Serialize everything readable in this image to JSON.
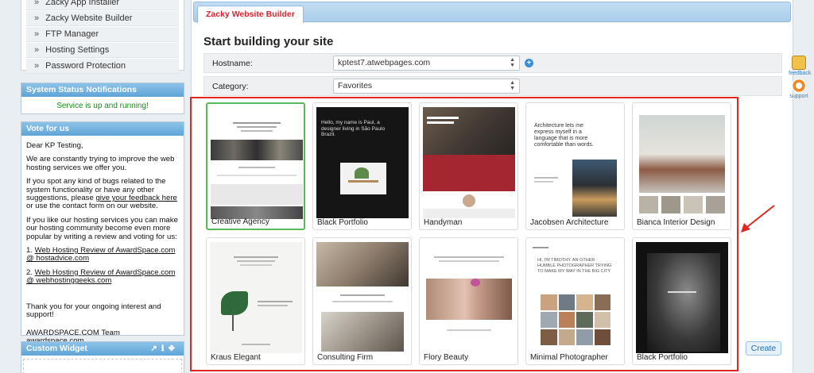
{
  "sidebar": {
    "menu_items": [
      {
        "label": "Zacky App Installer"
      },
      {
        "label": "Zacky Website Builder"
      },
      {
        "label": "FTP Manager"
      },
      {
        "label": "Hosting Settings"
      },
      {
        "label": "Password Protection"
      }
    ],
    "status_panel": {
      "title": "System Status Notifications",
      "message": "Service is up and running!"
    },
    "vote_panel": {
      "title": "Vote for us",
      "greeting": "Dear KP Testing,",
      "p1": "We are constantly trying to improve the web hosting services we offer you.",
      "p2_pre": "If you spot any kind of bugs related to the system functionality or have any other suggestions, please ",
      "p2_link": "give your feedback here",
      "p2_post": " or use the contact form on our website.",
      "p3": "If you like our hosting services you can make our hosting community become even more popular by writing a review and voting for us:",
      "link1_num": "1. ",
      "link1": "Web Hosting Review of AwardSpace.com @ hostadvice.com",
      "link2_num": "2. ",
      "link2": "Web Hosting Review of AwardSpace.com @ webhostinggeeks.com",
      "thanks": "Thank you for your ongoing interest and support!",
      "team": "AWARDSPACE.COM Team",
      "team_link": "awardspace.com"
    },
    "widget_panel": {
      "title": "Custom Widget"
    }
  },
  "main": {
    "tab_label": "Zacky Website Builder",
    "page_title": "Start building your site",
    "hostname_label": "Hostname:",
    "hostname_value": "kptest7.atwebpages.com",
    "category_label": "Category:",
    "category_value": "Favorites",
    "create_label": "Create",
    "templates": [
      {
        "name": "Creative Agency",
        "selected": true
      },
      {
        "name": "Black Portfolio"
      },
      {
        "name": "Handyman"
      },
      {
        "name": "Jacobsen Architecture"
      },
      {
        "name": "Bianca Interior Design"
      },
      {
        "name": "Kraus Elegant"
      },
      {
        "name": "Consulting Firm"
      },
      {
        "name": "Flory Beauty"
      },
      {
        "name": "Minimal Photographer"
      },
      {
        "name": "Black Portfolio"
      }
    ],
    "thumb_text": {
      "black_portfolio_1": "Hello, my name is Paul, a designer living in São Paulo Brazil.",
      "jacobsen": "Architecture lets me express myself in a language that is more comfortable than words.",
      "minimal_photographer": "HI, I'M TIMOTHY. AN OTHER HUMBLE PHOTOGRAPHER TRYING TO MAKE MY WAY IN THE BIG CITY"
    }
  },
  "floating": {
    "feedback_label": "feedback",
    "support_label": "support"
  },
  "colors": {
    "accent": "#d9232d",
    "panel_header": "#5fa4d8",
    "highlight_box": "#e0271f",
    "selected_card": "#58b85a"
  }
}
